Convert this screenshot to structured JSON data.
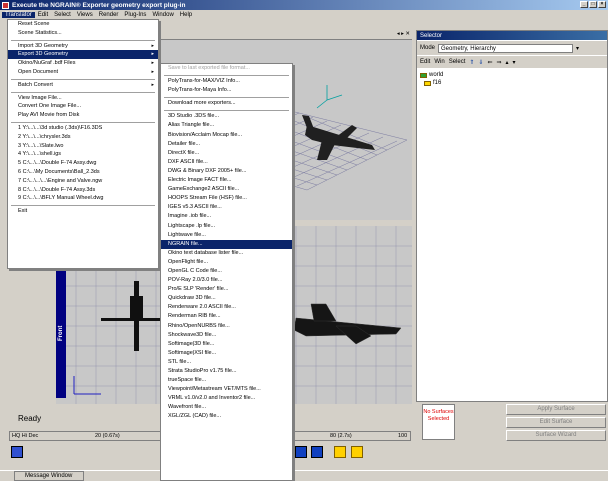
{
  "window": {
    "title": "Execute the NGRAIN® Exporter geometry export plug-in",
    "controls": [
      "_",
      "□",
      "×"
    ]
  },
  "menubar": [
    "Translator",
    "Edit",
    "Select",
    "Views",
    "Render",
    "Plug-Ins",
    "Window",
    "Help"
  ],
  "translator_menu": {
    "items": [
      {
        "label": "Reset Scene"
      },
      {
        "label": "Scene Statistics..."
      },
      {
        "sep": true
      },
      {
        "label": "Import 3D Geometry",
        "submenu": true
      },
      {
        "label": "Export 3D Geometry",
        "submenu": true,
        "selected": true
      },
      {
        "label": "Okino/NuGraf .bdf Files",
        "submenu": true
      },
      {
        "label": "Open Document",
        "submenu": true
      },
      {
        "sep": true
      },
      {
        "label": "Batch Convert",
        "submenu": true
      },
      {
        "sep": true
      },
      {
        "label": "View Image File..."
      },
      {
        "label": "Convert One Image File..."
      },
      {
        "label": "Play AVI Movie from Disk"
      },
      {
        "sep": true
      },
      {
        "label": "1 Y:\\...\\...\\3d studio (.3ds)\\F16.3DS"
      },
      {
        "label": "2 Y:\\...\\...\\chrysler.3ds"
      },
      {
        "label": "3 Y:\\...\\...\\Slate.lwo"
      },
      {
        "label": "4 Y:\\...\\...\\shell.igs"
      },
      {
        "label": "5 C:\\...\\...\\Double F-74 Assy.dwg"
      },
      {
        "label": "6 C:\\...\\My Documents\\Ball_2.3ds"
      },
      {
        "label": "7 C:\\...\\...\\...\\Engine and Valve.ngw"
      },
      {
        "label": "8 C:\\...\\...\\Double F-74 Assy.3ds"
      },
      {
        "label": "9 C:\\...\\...\\BFLY Manual Wheel.dwg"
      },
      {
        "sep": true
      },
      {
        "label": "Exit"
      }
    ]
  },
  "export_menu": {
    "items": [
      {
        "label": "Save to last exported file format...",
        "disabled": true
      },
      {
        "sep": true
      },
      {
        "label": "PolyTrans-for-MAX/VIZ Info..."
      },
      {
        "label": "PolyTrans-for-Maya Info..."
      },
      {
        "sep": true
      },
      {
        "label": "Download more exporters..."
      },
      {
        "sep": true
      },
      {
        "label": "3D Studio .3DS file..."
      },
      {
        "label": "Alias Triangle file..."
      },
      {
        "label": "Biovision/Acclaim Mocap file..."
      },
      {
        "label": "Detailer file..."
      },
      {
        "label": "DirectX file..."
      },
      {
        "label": "DXF ASCII file..."
      },
      {
        "label": "DWG & Binary DXF 2005+ file..."
      },
      {
        "label": "Electric Image FACT file..."
      },
      {
        "label": "GameExchange2 ASCII file..."
      },
      {
        "label": "HOOPS Stream File (HSF) file..."
      },
      {
        "label": "IGES v5.3 ASCII file..."
      },
      {
        "label": "Imagine .iob file..."
      },
      {
        "label": "Lightscape .lp file..."
      },
      {
        "label": "Lightwave file..."
      },
      {
        "label": "NGRAIN file...",
        "selected": true
      },
      {
        "label": "Okino text database lister file..."
      },
      {
        "label": "OpenFlight file..."
      },
      {
        "label": "OpenGL C Code file..."
      },
      {
        "label": "POV-Ray 2.0/3.0 file..."
      },
      {
        "label": "Pro/E SLP 'Render' file..."
      },
      {
        "label": "Quickdraw 3D file..."
      },
      {
        "label": "Renderware 2.0 ASCII file..."
      },
      {
        "label": "Renderman RIB file..."
      },
      {
        "label": "Rhino/OpenNURBS file..."
      },
      {
        "label": "Shockwave3D file..."
      },
      {
        "label": "Softimage|3D file..."
      },
      {
        "label": "Softimage|XSI file..."
      },
      {
        "label": "STL file..."
      },
      {
        "label": "Strata StudioPro v1.75 file..."
      },
      {
        "label": "trueSpace file..."
      },
      {
        "label": "Viewpoint/Metastream VET/MTS file..."
      },
      {
        "label": "VRML v1.0/v2.0 and Inventor2 file..."
      },
      {
        "label": "Wavefront file..."
      },
      {
        "label": "XGL/ZGL (CAD) file..."
      }
    ]
  },
  "selector": {
    "title": "Selector",
    "mode_label": "Mode",
    "mode_value": "Geometry, Hierarchy",
    "tools": [
      "Edit",
      "Win",
      "Select"
    ],
    "tree": [
      "world",
      "f16"
    ]
  },
  "viewport": {
    "front_label": "Front"
  },
  "surface_panel": {
    "no_surfaces": "No Surfaces Selected",
    "buttons": [
      "Apply Surface",
      "Edit Surface",
      "Surface Wizard"
    ]
  },
  "status": {
    "text": "Ready",
    "timeline": {
      "field": "HQ Hi Dec",
      "mid": "20 (0.67s)",
      "right": "80 (2.7s)",
      "end": "100"
    }
  },
  "message_window": {
    "label": "Message Window"
  }
}
